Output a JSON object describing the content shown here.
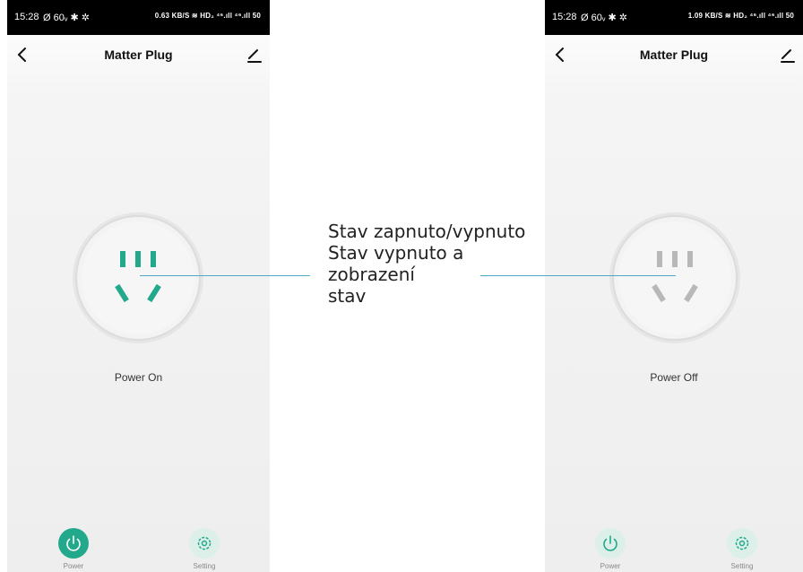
{
  "status": {
    "time": "15:28",
    "left_icons": "Ø 60ᵥ ✱ ✲",
    "right_icons_left": "0.63 KB/S ≋ HD₂ ⁴⁶.ıll ⁴⁶.ıll 50",
    "right_icons_right": "1.09 KB/S ≋ HD₂ ⁴⁶.ıll ⁴⁶.ıll 50"
  },
  "screen_on": {
    "title": "Matter Plug",
    "power_state": "Power On",
    "tab_power_label": "Power",
    "tab_setting_label": "Setting"
  },
  "screen_off": {
    "title": "Matter Plug",
    "power_state": "Power Off",
    "tab_power_label": "Power",
    "tab_setting_label": "Setting"
  },
  "annotation": {
    "line1": "Stav zapnuto/vypnuto",
    "line2": "Stav vypnuto a",
    "line3": "zobrazení",
    "line4": "stav"
  },
  "colors": {
    "accent": "#22a98c",
    "inactive": "#b8b8b8",
    "leader": "#4fa8c7"
  }
}
